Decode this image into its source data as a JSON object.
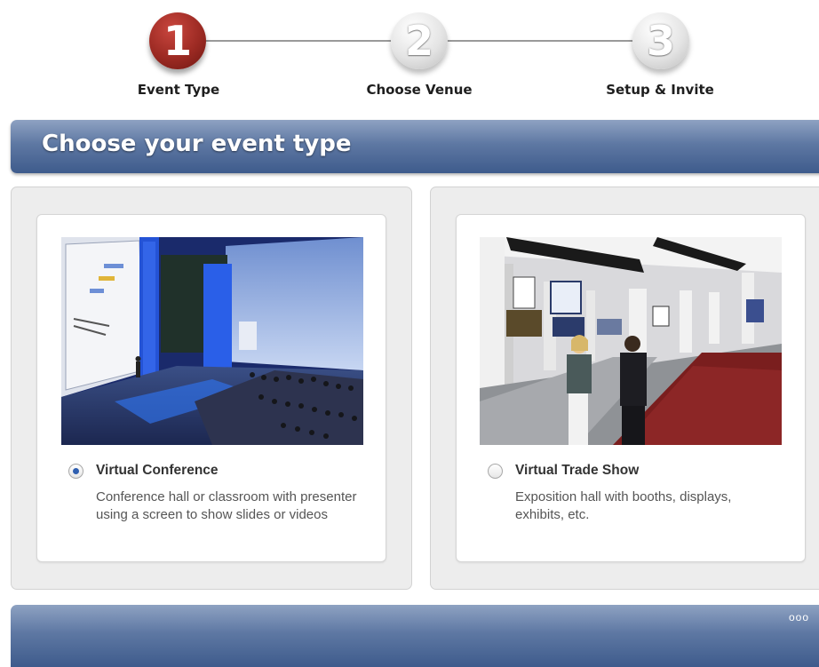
{
  "steps": [
    {
      "number": "1",
      "label": "Event Type",
      "state": "active"
    },
    {
      "number": "2",
      "label": "Choose Venue",
      "state": "inactive"
    },
    {
      "number": "3",
      "label": "Setup & Invite",
      "state": "inactive"
    }
  ],
  "header": {
    "title": "Choose your event type"
  },
  "options": [
    {
      "title": "Virtual Conference",
      "description": "Conference hall or classroom with presenter using a screen to show slides or videos",
      "selected": true
    },
    {
      "title": "Virtual Trade Show",
      "description": "Exposition hall with booths, displays, exhibits, etc.",
      "selected": false
    }
  ],
  "footer": {
    "dots": "ooo"
  },
  "colors": {
    "accent_red": "#9c2a23",
    "header_blue": "#5e78a3",
    "radio_selected": "#2f5fb0"
  }
}
